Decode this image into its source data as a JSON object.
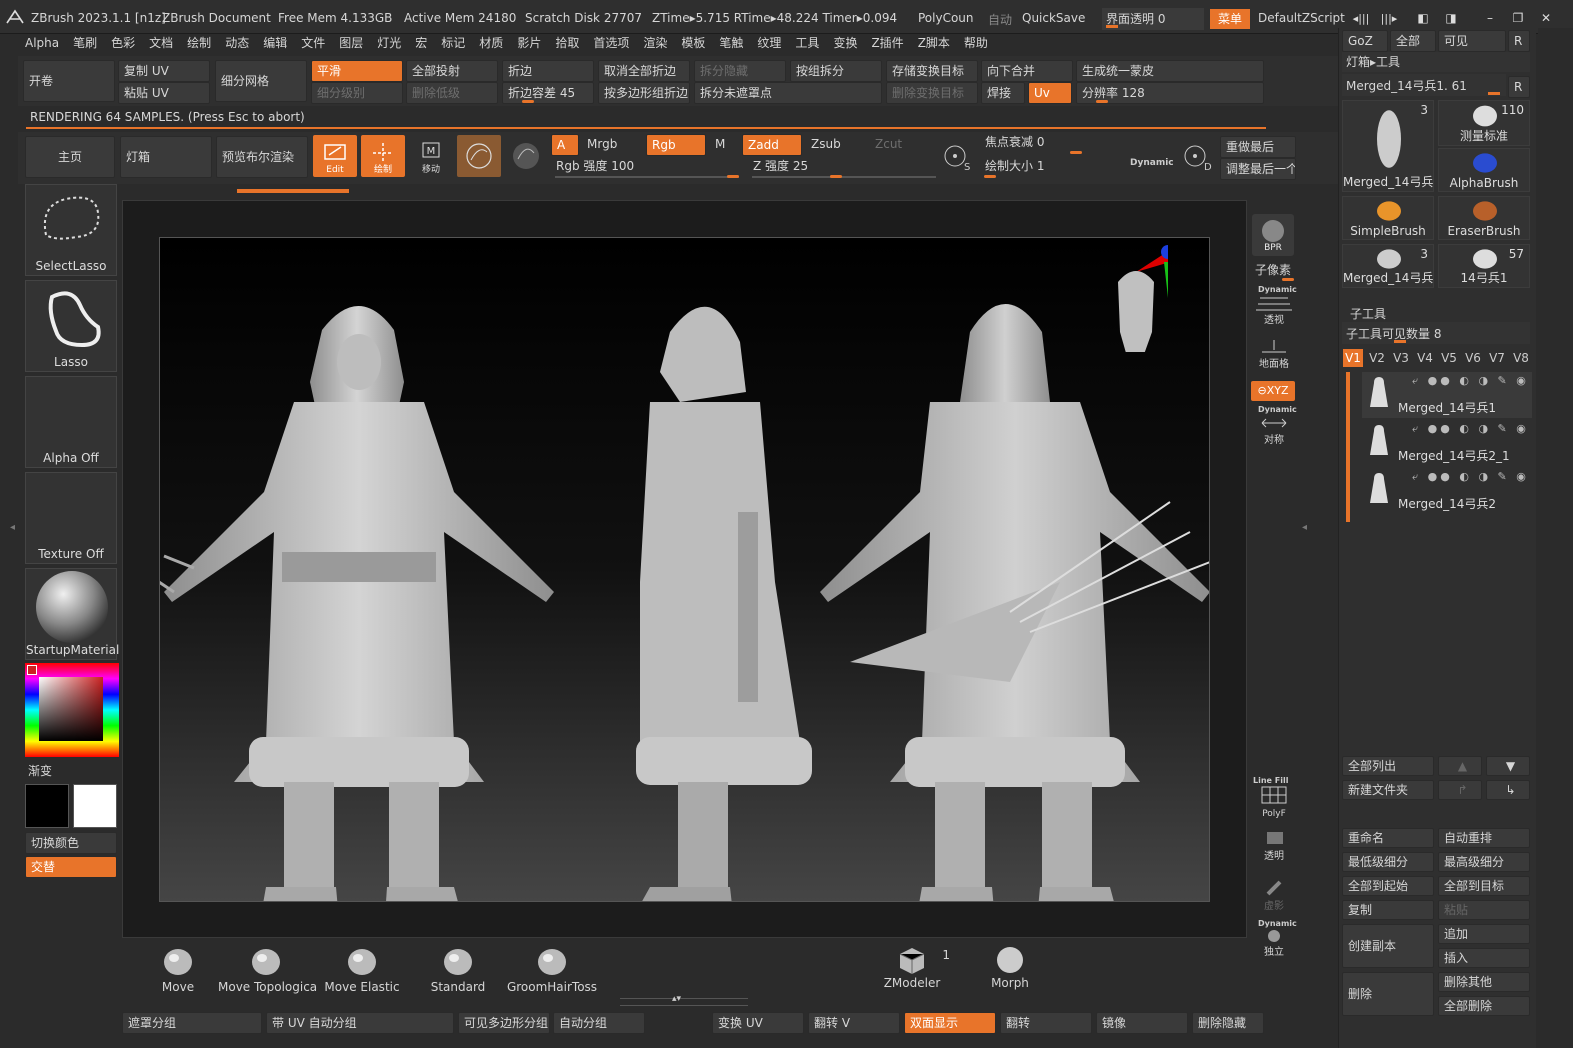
{
  "titlebar": {
    "app": "ZBrush 2023.1.1 [n1z]",
    "doc": "ZBrush Document",
    "free_mem": "Free Mem 4.133GB",
    "active_mem": "Active Mem 24180",
    "scratch": "Scratch Disk 27707",
    "ztime": "ZTime▸5.715 RTime▸48.224 Timer▸0.094",
    "polycount": "PolyCoun",
    "auto": "自动",
    "quicksave": "QuickSave",
    "transparency": "界面透明 0",
    "menu": "菜单",
    "script": "DefaultZScript"
  },
  "menubar": [
    "Alpha",
    "笔刷",
    "色彩",
    "文档",
    "绘制",
    "动态",
    "编辑",
    "文件",
    "图层",
    "灯光",
    "宏",
    "标记",
    "材质",
    "影片",
    "拾取",
    "首选项",
    "渲染",
    "模板",
    "笔触",
    "纹理",
    "工具",
    "变换",
    "Z插件",
    "Z脚本",
    "帮助"
  ],
  "topshelf": {
    "open": "开卷",
    "copy_uv": "复制 UV",
    "paste_uv": "粘贴 UV",
    "subdiv_mesh": "细分网格",
    "smooth": "平滑",
    "subdiv_level": "细分级别",
    "project_all": "全部投射",
    "del_lower": "删除低级",
    "crease": "折边",
    "crease_tol": "折边容差 45",
    "uncrease_all": "取消全部折边",
    "poly_crease": "按多边形组折边",
    "split_hidden": "拆分隐藏",
    "split_unmasked": "拆分未遮罩点",
    "group_split": "按组拆分",
    "store_morph": "存储变换目标",
    "del_morph": "删除变换目标",
    "merge_down": "向下合并",
    "weld": "焊接",
    "uv": "Uv",
    "unified_skin": "生成统一蒙皮",
    "resolution": "分辨率 128"
  },
  "render_status": "RENDERING 64 SAMPLES. (Press Esc to abort)",
  "toolbar2": {
    "home": "主页",
    "lightbox": "灯箱",
    "bpr_preview": "预览布尔渲染",
    "edit": "Edit",
    "draw": "绘制",
    "move": "移动",
    "a": "A",
    "mrgb": "Mrgb",
    "rgb": "Rgb",
    "m": "M",
    "zadd": "Zadd",
    "zsub": "Zsub",
    "zcut": "Zcut",
    "rgb_intensity": "Rgb 强度 100",
    "z_intensity": "Z 强度 25",
    "focal_shift": "焦点衰减 0",
    "draw_size": "绘制大小 1",
    "dynamic": "Dynamic",
    "redo_last": "重做最后",
    "adjust_last": "调整最后一个"
  },
  "leftpanel": {
    "selectlasso": "SelectLasso",
    "lasso": "Lasso",
    "alpha_off": "Alpha Off",
    "texture_off": "Texture Off",
    "material": "StartupMaterial",
    "gradient": "渐变",
    "switch_color": "切换颜色",
    "alternate": "交替"
  },
  "rightshelf": {
    "bpr": "BPR",
    "subpixel": "子像素",
    "dynamic": "Dynamic",
    "persp": "透视",
    "floor": "地面格",
    "xyz": "⊖XYZ",
    "dynamic2": "Dynamic",
    "sym": "对称",
    "linefill": "Line Fill",
    "polyf": "PolyF",
    "transp": "透明",
    "ghost": "虚影",
    "dynamic3": "Dynamic",
    "solo": "独立"
  },
  "toolpanel": {
    "goz": "GoZ",
    "all": "全部",
    "visible": "可见",
    "r": "R",
    "header": "灯箱▸工具",
    "current_tool": "Merged_14弓兵1. 61",
    "tools": [
      {
        "label": "Merged_14弓兵1",
        "count": "3"
      },
      {
        "label": "测量标准",
        "count": "110"
      },
      {
        "label": "AlphaBrush",
        "count": ""
      },
      {
        "label": "SimpleBrush",
        "count": ""
      },
      {
        "label": "EraserBrush",
        "count": ""
      },
      {
        "label": "Merged_14弓兵1",
        "count": "3"
      },
      {
        "label": "14弓兵1",
        "count": "57"
      }
    ],
    "subtool_title": "子工具",
    "subtool_visible": "子工具可见数量 8",
    "vtabs": [
      "V1",
      "V2",
      "V3",
      "V4",
      "V5",
      "V6",
      "V7",
      "V8"
    ],
    "subtools": [
      "Merged_14弓兵1",
      "Merged_14弓兵2_1",
      "Merged_14弓兵2"
    ],
    "list_all": "全部列出",
    "new_folder": "新建文件夹",
    "rename": "重命名",
    "auto_reorder": "自动重排",
    "lowest_res": "最低级细分",
    "highest_res": "最高级细分",
    "all_to_start": "全部到起始",
    "all_to_target": "全部到目标",
    "duplicate": "复制",
    "paste": "粘贴",
    "create_instance": "创建副本",
    "append": "追加",
    "insert": "插入",
    "delete": "删除",
    "del_other": "删除其他",
    "del_all": "全部删除"
  },
  "bottom_brushes": [
    "Move",
    "Move Topologica",
    "Move Elastic",
    "Standard",
    "GroomHairToss"
  ],
  "bottom_right": {
    "zmodeler": "ZModeler",
    "zmodeler_count": "1",
    "morph": "Morph"
  },
  "bottombar": {
    "mask_group": "遮罩分组",
    "uv_autogroup": "带 UV 自动分组",
    "visible_polygroup": "可见多边形分组",
    "auto_group": "自动分组",
    "transform_uv": "变换 UV",
    "flip_v": "翻转 V",
    "double_sided": "双面显示",
    "flip": "翻转",
    "mirror": "镜像",
    "del_hidden": "删除隐藏"
  },
  "colors": {
    "accent": "#e8742a",
    "panel": "#2b2b2b",
    "button": "#3a3a3a"
  }
}
